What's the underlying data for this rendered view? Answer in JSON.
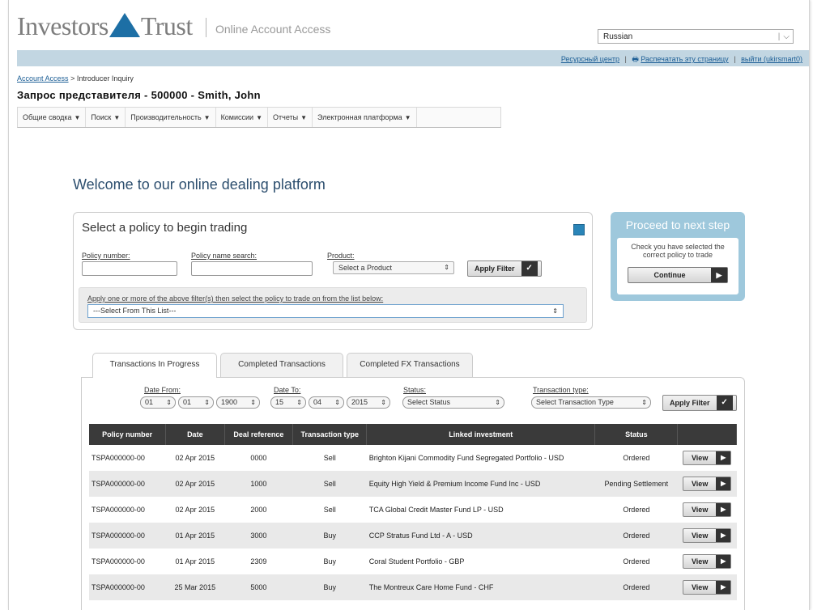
{
  "header": {
    "logo_left": "Investors",
    "logo_right": "Trust",
    "tagline": "Online Account Access",
    "language": "Russian",
    "links": [
      "Ресурсный центр",
      "Распечатать эту страницу",
      "выйти (ukirsmart0)"
    ]
  },
  "breadcrumb": {
    "root": "Account Access",
    "separator": ">",
    "current": "Introducer Inquiry"
  },
  "page_title": "Запрос представителя - 500000 - Smith, John",
  "menu": [
    "Общие сводка",
    "Поиск",
    "Производительность",
    "Комиссии",
    "Отчеты",
    "Электронная платформа"
  ],
  "welcome": "Welcome to our online dealing platform",
  "policy": {
    "title": "Select a policy to begin trading",
    "policy_number_label": "Policy number:",
    "policy_name_label": "Policy name search:",
    "product_label": "Product:",
    "product_value": "Select a Product",
    "apply_label": "Apply Filter",
    "hint": "Apply one or more of the above filter(s) then select the policy to trade on from the list below:",
    "list_value": "---Select From This List---"
  },
  "next_step": {
    "title": "Proceed to next step",
    "text": "Check you have selected the correct policy to trade",
    "button": "Continue"
  },
  "tabs": [
    "Transactions In Progress",
    "Completed Transactions",
    "Completed FX Transactions"
  ],
  "filters": {
    "date_from_label": "Date From:",
    "date_from": [
      "01",
      "01",
      "1900"
    ],
    "date_to_label": "Date To:",
    "date_to": [
      "15",
      "04",
      "2015"
    ],
    "status_label": "Status:",
    "status_value": "Select Status",
    "type_label": "Transaction type:",
    "type_value": "Select Transaction Type",
    "apply_label": "Apply Filter"
  },
  "table": {
    "columns": [
      "Policy number",
      "Date",
      "Deal reference",
      "Transaction type",
      "Linked investment",
      "Status",
      ""
    ],
    "view_label": "View",
    "rows": [
      [
        "TSPA000000-00",
        "02 Apr 2015",
        "0000",
        "Sell",
        "Brighton Kijani Commodity Fund Segregated Portfolio - USD",
        "Ordered"
      ],
      [
        "TSPA000000-00",
        "02 Apr 2015",
        "1000",
        "Sell",
        "Equity High Yield & Premium Income Fund Inc - USD",
        "Pending Settlement"
      ],
      [
        "TSPA000000-00",
        "02 Apr 2015",
        "2000",
        "Sell",
        "TCA Global Credit Master Fund LP - USD",
        "Ordered"
      ],
      [
        "TSPA000000-00",
        "01 Apr 2015",
        "3000",
        "Buy",
        "CCP Stratus Fund Ltd - A - USD",
        "Ordered"
      ],
      [
        "TSPA000000-00",
        "01 Apr 2015",
        "2309",
        "Buy",
        "Coral Student Portfolio - GBP",
        "Ordered"
      ],
      [
        "TSPA000000-00",
        "25 Mar 2015",
        "5000",
        "Buy",
        "The Montreux Care Home Fund - CHF",
        "Ordered"
      ]
    ]
  }
}
